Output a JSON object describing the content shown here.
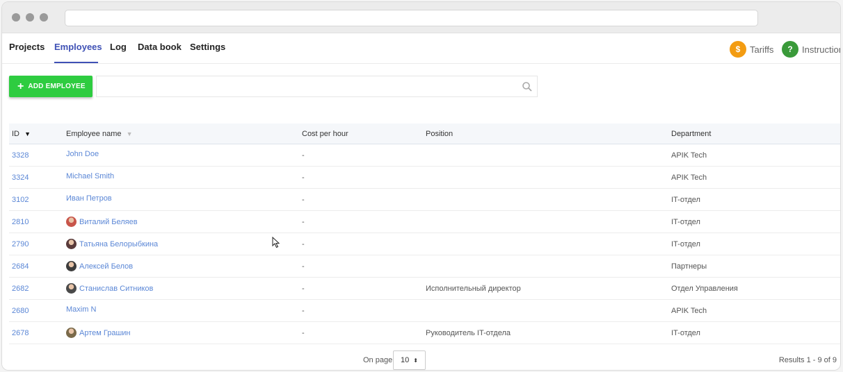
{
  "nav": {
    "tabs": [
      {
        "label": "Projects"
      },
      {
        "label": "Employees"
      },
      {
        "label": "Log"
      },
      {
        "label": "Data book"
      },
      {
        "label": "Settings"
      }
    ],
    "active_tab": "Employees",
    "tariffs": {
      "icon_text": "$",
      "label": "Tariffs",
      "color": "#f39c12"
    },
    "instruction": {
      "icon_text": "?",
      "label": "Instruction",
      "color": "#3a9a3a"
    }
  },
  "toolbar": {
    "add_button_icon": "+",
    "add_button_label": "ADD EMPLOYEE",
    "add_button_color": "#2ecc40",
    "search_value": "",
    "search_icon": "search-icon"
  },
  "table": {
    "columns": {
      "id": "ID",
      "name": "Employee name",
      "cost": "Cost per hour",
      "position": "Position",
      "department": "Department"
    },
    "rows": [
      {
        "id": "3328",
        "name": "John Doe",
        "cost": "-",
        "position": "",
        "department": "APIK Tech",
        "avatar": false
      },
      {
        "id": "3324",
        "name": "Michael Smith",
        "cost": "-",
        "position": "",
        "department": "APIK Tech",
        "avatar": false
      },
      {
        "id": "3102",
        "name": "Иван Петров",
        "cost": "-",
        "position": "",
        "department": "IT-отдел",
        "avatar": false
      },
      {
        "id": "2810",
        "name": "Виталий Беляев",
        "cost": "-",
        "position": "",
        "department": "IT-отдел",
        "avatar": true,
        "avatar_color": "#c8554a"
      },
      {
        "id": "2790",
        "name": "Татьяна Белорыбкина",
        "cost": "-",
        "position": "",
        "department": "IT-отдел",
        "avatar": true,
        "avatar_color": "#5a3b3b"
      },
      {
        "id": "2684",
        "name": "Алексей Белов",
        "cost": "-",
        "position": "",
        "department": "Партнеры",
        "avatar": true,
        "avatar_color": "#3d3d3d"
      },
      {
        "id": "2682",
        "name": "Станислав Ситников",
        "cost": "-",
        "position": "Исполнительный директор",
        "department": "Отдел Управления",
        "avatar": true,
        "avatar_color": "#4a4a4a"
      },
      {
        "id": "2680",
        "name": "Maxim N",
        "cost": "-",
        "position": "",
        "department": "APIK Tech",
        "avatar": false
      },
      {
        "id": "2678",
        "name": "Артем Грашин",
        "cost": "-",
        "position": "Руководитель IT-отдела",
        "department": "IT-отдел",
        "avatar": true,
        "avatar_color": "#7a6a4a"
      }
    ]
  },
  "footer": {
    "on_page_label": "On page",
    "page_size": "10",
    "results": "Results 1 - 9 of 9"
  }
}
